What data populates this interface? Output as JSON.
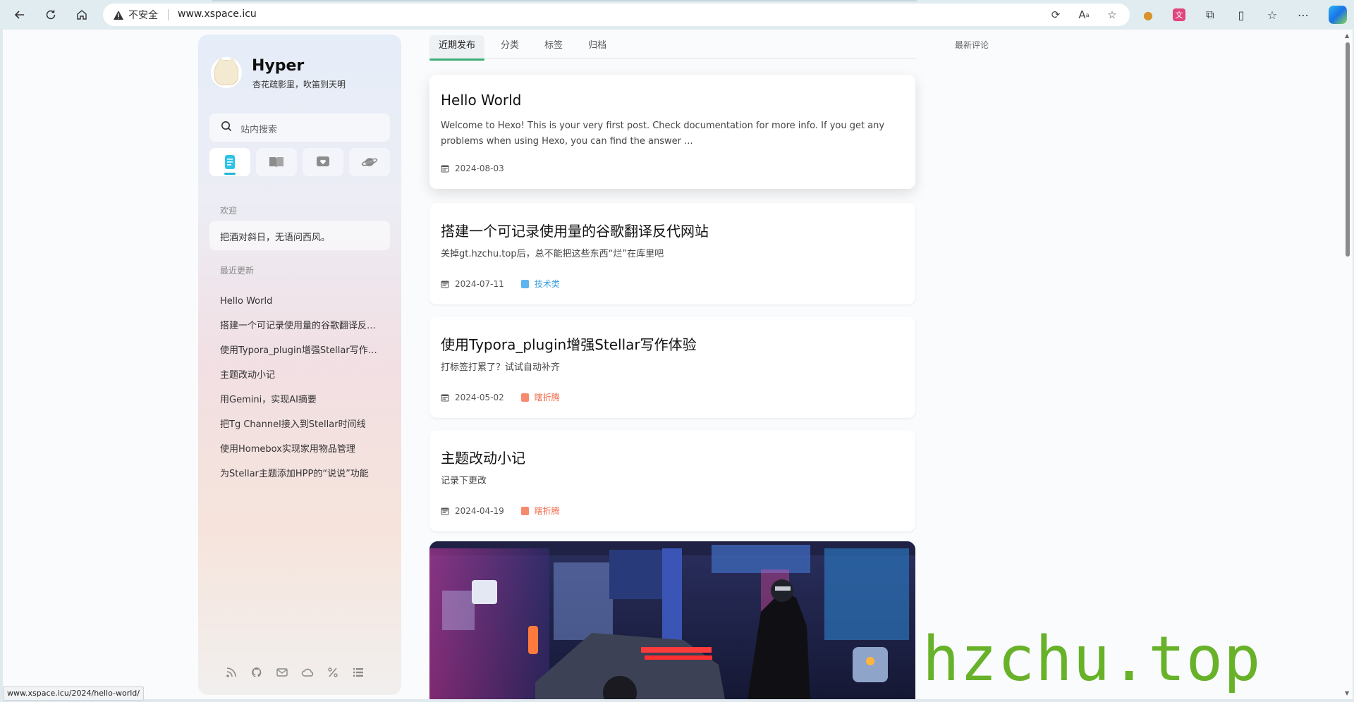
{
  "browser": {
    "security_label": "不安全",
    "url": "www.xspace.icu",
    "status_url": "www.xspace.icu/2024/hello-world/"
  },
  "sidebar": {
    "title": "Hyper",
    "subtitle": "杏花疏影里，吹笛到天明",
    "search_placeholder": "站内搜索",
    "tabs": [
      "posts",
      "wiki",
      "notes",
      "explore"
    ],
    "welcome_label": "欢迎",
    "welcome_text": "把酒对斜日，无语问西风。",
    "recent_label": "最近更新",
    "recent": [
      "Hello World",
      "搭建一个可记录使用量的谷歌翻译反代网站",
      "使用Typora_plugin增强Stellar写作体验",
      "主题改动小记",
      "用Gemini，实现AI摘要",
      "把Tg Channel接入到Stellar时间线",
      "使用Homebox实现家用物品管理",
      "为Stellar主题添加HPP的“说说”功能"
    ]
  },
  "main": {
    "tabs": [
      "近期发布",
      "分类",
      "标签",
      "归档"
    ],
    "comments_title": "最新评论",
    "posts": [
      {
        "title": "Hello World",
        "excerpt": "Welcome to Hexo! This is your very first post. Check documentation for more info. If you get any problems when using Hexo, you can find the answer ...",
        "date": "2024-08-03",
        "category": ""
      },
      {
        "title": "搭建一个可记录使用量的谷歌翻译反代网站",
        "excerpt": "关掉gt.hzchu.top后，总不能把这些东西“烂”在库里吧",
        "date": "2024-07-11",
        "category": "技术类",
        "category_color": "#3a9ee0"
      },
      {
        "title": "使用Typora_plugin增强Stellar写作体验",
        "excerpt": "打标签打累了？试试自动补齐",
        "date": "2024-05-02",
        "category": "瞎折腾",
        "category_color": "#f0694a"
      },
      {
        "title": "主题改动小记",
        "excerpt": "记录下更改",
        "date": "2024-04-19",
        "category": "瞎折腾",
        "category_color": "#f0694a"
      }
    ]
  },
  "watermark": "hzchu.top",
  "colors": {
    "accent_green": "#3cae75",
    "active_tab_blue": "#1fb7d4",
    "watermark_green": "#68b22a"
  }
}
